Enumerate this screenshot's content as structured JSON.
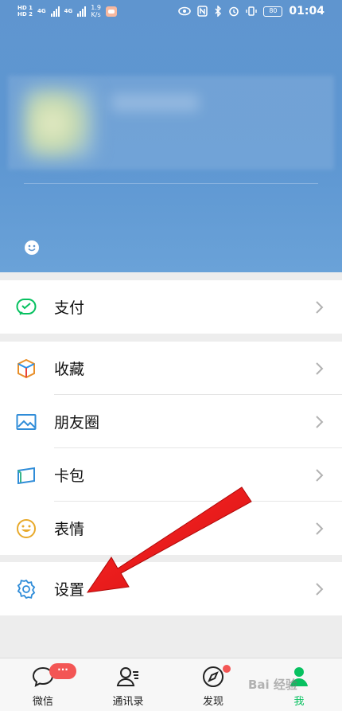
{
  "statusbar": {
    "hd1": "HD 1",
    "hd2": "HD 2",
    "net1": "4G",
    "net2": "4G",
    "speed_value": "1.9",
    "speed_unit": "K/s",
    "battery": "80",
    "time": "01:04"
  },
  "menu": {
    "pay": {
      "label": "支付",
      "icon": "wechat-pay-icon"
    },
    "favorites": {
      "label": "收藏",
      "icon": "cube-icon"
    },
    "moments": {
      "label": "朋友圈",
      "icon": "picture-icon"
    },
    "cards": {
      "label": "卡包",
      "icon": "card-icon"
    },
    "stickers": {
      "label": "表情",
      "icon": "smiley-icon"
    },
    "settings": {
      "label": "设置",
      "icon": "gear-icon"
    }
  },
  "tabbar": {
    "chats": {
      "label": "微信",
      "badge": "···"
    },
    "contacts": {
      "label": "通讯录"
    },
    "discover": {
      "label": "发现"
    },
    "me": {
      "label": "我"
    }
  },
  "watermark": "Bai 经验",
  "colors": {
    "header_blue": "#5f95cf",
    "wechat_green": "#07c160",
    "badge_red": "#f35655",
    "arrow_red": "#e81b1b"
  }
}
